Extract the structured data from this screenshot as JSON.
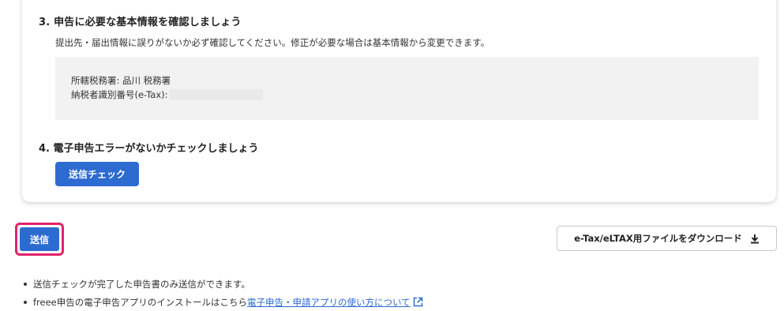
{
  "step3": {
    "heading": "3. 申告に必要な基本情報を確認しましょう",
    "description": "提出先・届出情報に誤りがないか必ず確認してください。修正が必要な場合は基本情報から変更できます。",
    "tax_office_label": "所轄税務署: 品川 税務署",
    "taxpayer_id_label": "納税者識別番号(e-Tax):"
  },
  "step4": {
    "heading": "4. 電子申告エラーがないかチェックしましょう",
    "check_button_label": "送信チェック"
  },
  "actions": {
    "send_label": "送信",
    "download_label": "e-Tax/eLTAX用ファイルをダウンロード",
    "download_icon": "download-icon"
  },
  "notes": {
    "note1": "送信チェックが完了した申告書のみ送信ができます。",
    "note2_prefix": "freee申告の電子申告アプリのインストールはこちら",
    "note2_link": "電子申告・申請アプリの使い方について",
    "note2_icon": "external-link-icon"
  },
  "colors": {
    "primary": "#2d6bd1",
    "highlight": "#e0236b",
    "info_bg": "#f2f2f2"
  }
}
